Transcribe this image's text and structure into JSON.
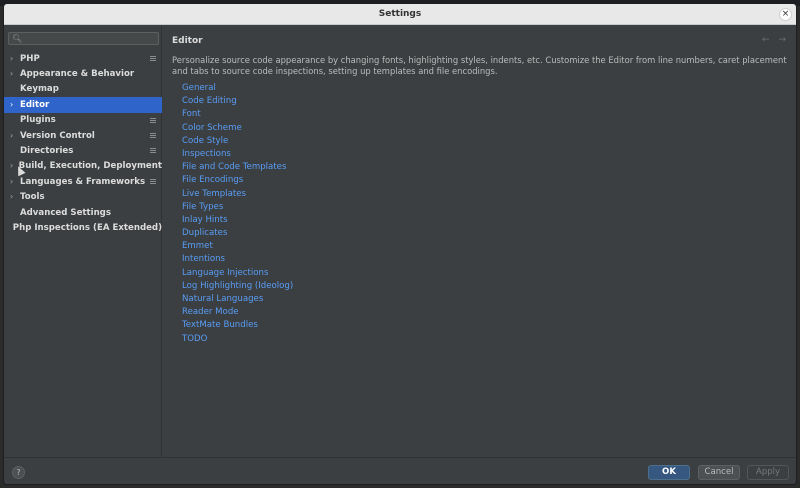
{
  "window": {
    "title": "Settings",
    "close_glyph": "×"
  },
  "search": {
    "placeholder": "",
    "icon": "search-icon"
  },
  "sidebar": {
    "items": [
      {
        "label": "PHP",
        "arrow": "›",
        "badge": true,
        "selected": false
      },
      {
        "label": "Appearance & Behavior",
        "arrow": "›",
        "badge": false,
        "selected": false
      },
      {
        "label": "Keymap",
        "arrow": "",
        "badge": false,
        "selected": false
      },
      {
        "label": "Editor",
        "arrow": "›",
        "badge": false,
        "selected": true
      },
      {
        "label": "Plugins",
        "arrow": "",
        "badge": true,
        "selected": false
      },
      {
        "label": "Version Control",
        "arrow": "›",
        "badge": true,
        "selected": false
      },
      {
        "label": "Directories",
        "arrow": "",
        "badge": true,
        "selected": false
      },
      {
        "label": "Build, Execution, Deployment",
        "arrow": "›",
        "badge": false,
        "selected": false
      },
      {
        "label": "Languages & Frameworks",
        "arrow": "›",
        "badge": true,
        "selected": false
      },
      {
        "label": "Tools",
        "arrow": "›",
        "badge": false,
        "selected": false
      },
      {
        "label": "Advanced Settings",
        "arrow": "",
        "badge": false,
        "selected": false
      },
      {
        "label": "Php Inspections (EA Extended)",
        "arrow": "",
        "badge": false,
        "selected": false
      }
    ]
  },
  "content": {
    "heading": "Editor",
    "nav_arrows": "← →",
    "description": "Personalize source code appearance by changing fonts, highlighting styles, indents, etc. Customize the Editor from line numbers, caret placement and tabs to source code inspections, setting up templates and file encodings.",
    "links": [
      "General",
      "Code Editing",
      "Font",
      "Color Scheme",
      "Code Style",
      "Inspections",
      "File and Code Templates",
      "File Encodings",
      "Live Templates",
      "File Types",
      "Inlay Hints",
      "Duplicates",
      "Emmet",
      "Intentions",
      "Language Injections",
      "Log Highlighting (Ideolog)",
      "Natural Languages",
      "Reader Mode",
      "TextMate Bundles",
      "TODO"
    ]
  },
  "footer": {
    "help": "?",
    "ok": "OK",
    "cancel": "Cancel",
    "apply": "Apply"
  },
  "colors": {
    "accent": "#2f65ca",
    "link": "#589df6",
    "background": "#3c3f41",
    "ok_button": "#365880"
  }
}
